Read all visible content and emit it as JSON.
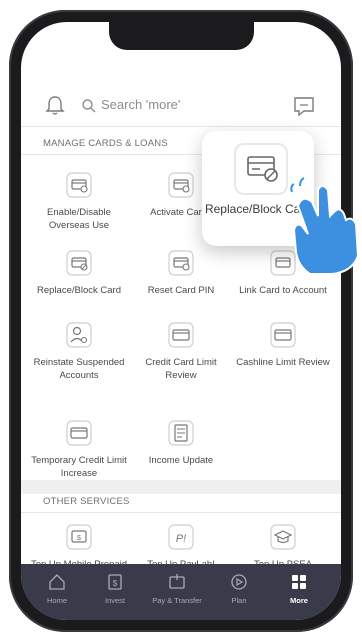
{
  "search": {
    "placeholder": "Search 'more'"
  },
  "icons": {
    "bell": "bell-icon",
    "search": "search-icon",
    "chat": "chat-icon",
    "hand": "pointing-hand-icon"
  },
  "sections": {
    "manage_title": "MANAGE CARDS & LOANS",
    "other_title": "OTHER SERVICES"
  },
  "manage_items": [
    "Enable/Disable Overseas Use",
    "Activate Cards",
    "",
    "Replace/Block Card",
    "Reset Card PIN",
    "Link Card to Account",
    "Reinstate Suspended Accounts",
    "Credit Card Limit Review",
    "Cashline Limit Review",
    "Temporary Credit Limit Increase",
    "Income Update"
  ],
  "other_items": [
    "Top Up Mobile Prepaid",
    "Top Up PayLah!",
    "Top Up PSEA"
  ],
  "popup": {
    "label": "Replace/Block Card"
  },
  "bottom_nav": {
    "tabs": [
      {
        "label": "Home",
        "icon": "home-icon"
      },
      {
        "label": "Invest",
        "icon": "invest-icon"
      },
      {
        "label": "Pay & Transfer",
        "icon": "pay-transfer-icon"
      },
      {
        "label": "Plan",
        "icon": "plan-icon"
      },
      {
        "label": "More",
        "icon": "more-grid-icon",
        "active": true
      }
    ]
  },
  "colors": {
    "nav_bg": "#3a3b4a",
    "hand": "#3d8fe0",
    "accent_text": "#4a4a4a"
  }
}
